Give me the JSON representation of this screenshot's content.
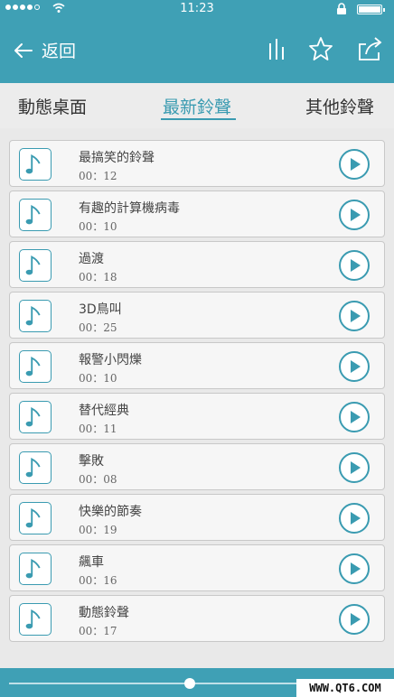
{
  "status_bar": {
    "time": "11:23",
    "signal_icon": "signal-dots-icon",
    "wifi_icon": "wifi-icon",
    "lock_icon": "lock-icon",
    "battery_icon": "battery-icon"
  },
  "header": {
    "back_label": "返回",
    "back_icon": "arrow-left-icon",
    "actions": [
      "equalizer-icon",
      "star-icon",
      "share-icon"
    ]
  },
  "tabs": [
    {
      "label": "動態桌面"
    },
    {
      "label": "最新鈴聲",
      "active": true
    },
    {
      "label": "其他鈴聲"
    }
  ],
  "ringtones": [
    {
      "title": "最搞笑的鈴聲",
      "duration": "00：12"
    },
    {
      "title": "有趣的計算機病毒",
      "duration": "00：10"
    },
    {
      "title": "過渡",
      "duration": "00：18"
    },
    {
      "title": "3D鳥叫",
      "duration": "00：25"
    },
    {
      "title": "報警小閃爍",
      "duration": "00：10"
    },
    {
      "title": "替代經典",
      "duration": "00：11"
    },
    {
      "title": "擊敗",
      "duration": "00：08"
    },
    {
      "title": "快樂的節奏",
      "duration": "00：19"
    },
    {
      "title": "飆車",
      "duration": "00：16"
    },
    {
      "title": "動態鈴聲",
      "duration": "00：17"
    }
  ],
  "colors": {
    "accent": "#3fa0b5",
    "tab_active": "#3a9bb1"
  },
  "watermark": "WWW.QT6.COM"
}
